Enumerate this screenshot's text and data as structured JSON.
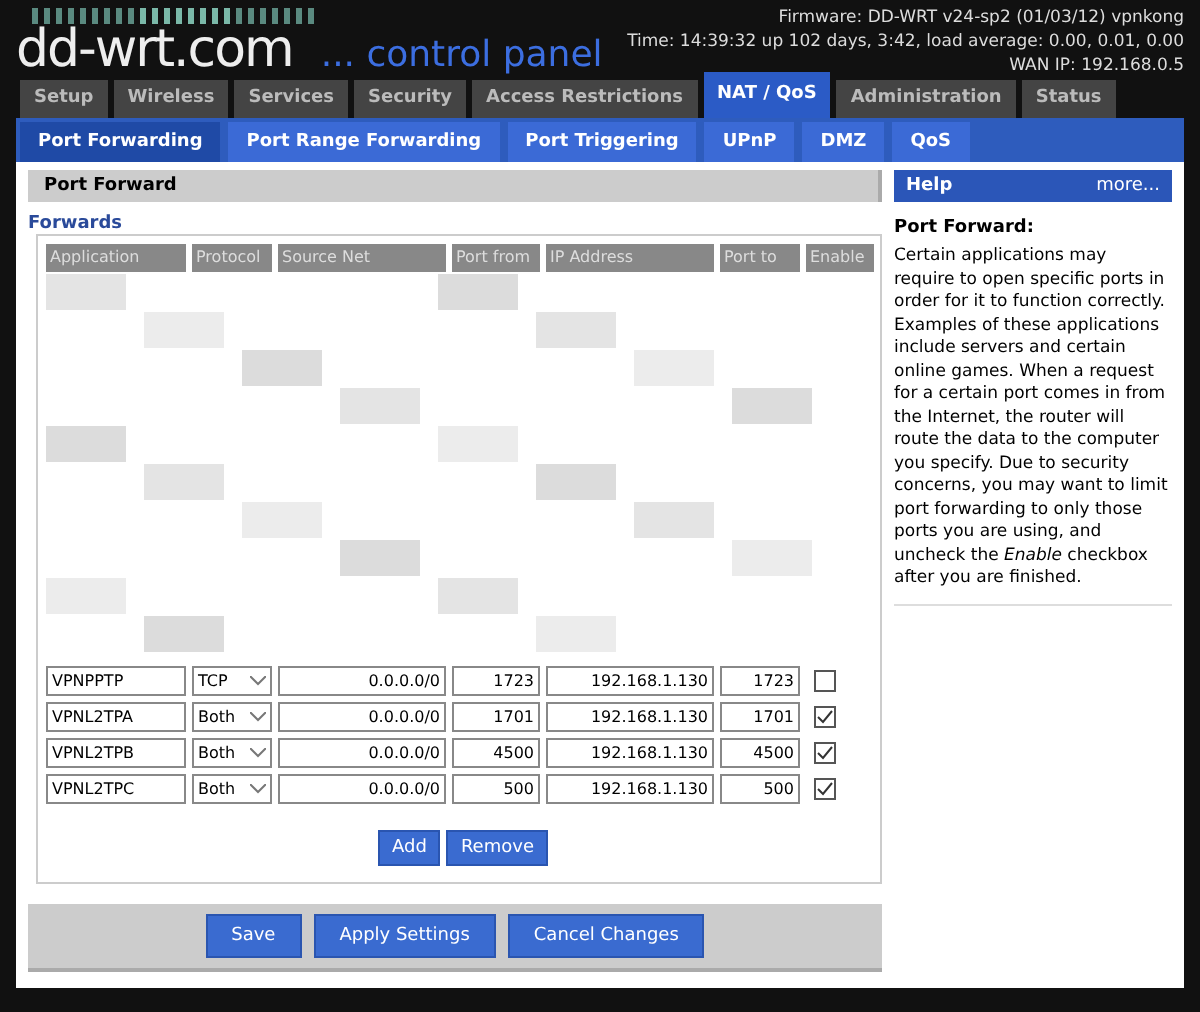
{
  "header": {
    "logo": "dd-wrt.com",
    "subtitle": "... control panel",
    "firmware": "Firmware: DD-WRT v24-sp2 (01/03/12) vpnkong",
    "time": "Time: 14:39:32 up 102 days, 3:42, load average: 0.00, 0.01, 0.00",
    "wan_ip": "WAN IP: 192.168.0.5"
  },
  "tabs": [
    {
      "label": "Setup",
      "selected": false
    },
    {
      "label": "Wireless",
      "selected": false
    },
    {
      "label": "Services",
      "selected": false
    },
    {
      "label": "Security",
      "selected": false
    },
    {
      "label": "Access Restrictions",
      "selected": false
    },
    {
      "label": "NAT / QoS",
      "selected": true
    },
    {
      "label": "Administration",
      "selected": false
    },
    {
      "label": "Status",
      "selected": false
    }
  ],
  "subtabs": [
    {
      "label": "Port Forwarding",
      "selected": true
    },
    {
      "label": "Port Range Forwarding",
      "selected": false
    },
    {
      "label": "Port Triggering",
      "selected": false
    },
    {
      "label": "UPnP",
      "selected": false
    },
    {
      "label": "DMZ",
      "selected": false
    },
    {
      "label": "QoS",
      "selected": false
    }
  ],
  "section_title": "Port Forward",
  "fieldset_legend": "Forwards",
  "table": {
    "columns": [
      "Application",
      "Protocol",
      "Source Net",
      "Port from",
      "IP Address",
      "Port to",
      "Enable"
    ],
    "rows": [
      {
        "application": "VPNPPTP",
        "protocol": "TCP",
        "source_net": "0.0.0.0/0",
        "port_from": "1723",
        "ip_address": "192.168.1.130",
        "port_to": "1723",
        "enabled": false
      },
      {
        "application": "VPNL2TPA",
        "protocol": "Both",
        "source_net": "0.0.0.0/0",
        "port_from": "1701",
        "ip_address": "192.168.1.130",
        "port_to": "1701",
        "enabled": true
      },
      {
        "application": "VPNL2TPB",
        "protocol": "Both",
        "source_net": "0.0.0.0/0",
        "port_from": "4500",
        "ip_address": "192.168.1.130",
        "port_to": "4500",
        "enabled": true
      },
      {
        "application": "VPNL2TPC",
        "protocol": "Both",
        "source_net": "0.0.0.0/0",
        "port_from": "500",
        "ip_address": "192.168.1.130",
        "port_to": "500",
        "enabled": true
      }
    ]
  },
  "table_buttons": [
    "Add",
    "Remove"
  ],
  "help": {
    "title": "Help",
    "more": "more...",
    "heading": "Port Forward:",
    "text": "Certain applications may require to open specific ports in order for it to function correctly. Examples of these applications include servers and certain online games. When a request for a certain port comes in from the Internet, the router will route the data to the computer you specify. Due to security concerns, you may want to limit port forwarding to only those ports you are using, and uncheck the *Enable* checkbox after you are finished."
  },
  "footer_buttons": [
    "Save",
    "Apply Settings",
    "Cancel Changes"
  ]
}
